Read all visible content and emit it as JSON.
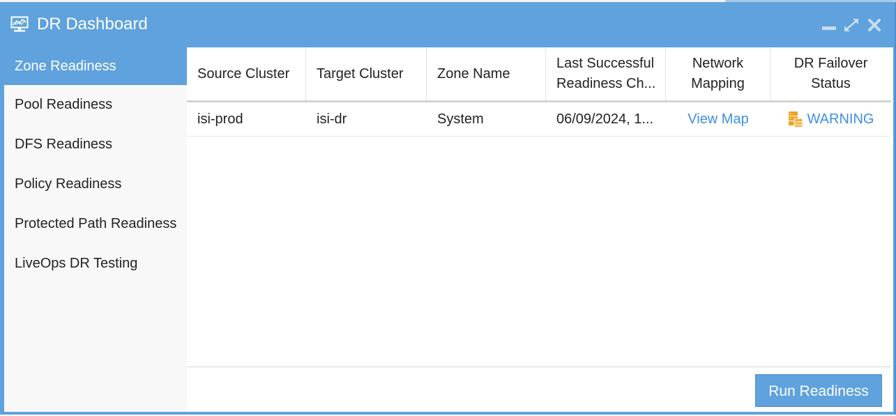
{
  "window": {
    "title": "DR Dashboard",
    "title_icon": "monitor-chart-icon",
    "controls": [
      "minimize-icon",
      "maximize-icon",
      "close-icon"
    ],
    "accent_color": "#5fa2dd"
  },
  "sidebar": {
    "items": [
      {
        "label": "Zone Readiness",
        "active": true
      },
      {
        "label": "Pool Readiness",
        "active": false
      },
      {
        "label": "DFS Readiness",
        "active": false
      },
      {
        "label": "Policy Readiness",
        "active": false
      },
      {
        "label": "Protected Path Readiness",
        "active": false
      },
      {
        "label": "LiveOps DR Testing",
        "active": false
      }
    ]
  },
  "table": {
    "columns": [
      {
        "label": "Source Cluster"
      },
      {
        "label": "Target Cluster"
      },
      {
        "label": "Zone Name"
      },
      {
        "label_line1": "Last Successful",
        "label_line2": "Readiness Ch..."
      },
      {
        "label_line1": "Network",
        "label_line2": "Mapping"
      },
      {
        "label_line1": "DR Failover",
        "label_line2": "Status"
      }
    ],
    "rows": [
      {
        "source_cluster": "isi-prod",
        "target_cluster": "isi-dr",
        "zone_name": "System",
        "last_check": "06/09/2024, 1...",
        "network_mapping": "View Map",
        "status": "WARNING",
        "status_icon": "warning-server-icon",
        "status_color": "#f0a020"
      }
    ]
  },
  "footer": {
    "run_button": "Run Readiness"
  }
}
